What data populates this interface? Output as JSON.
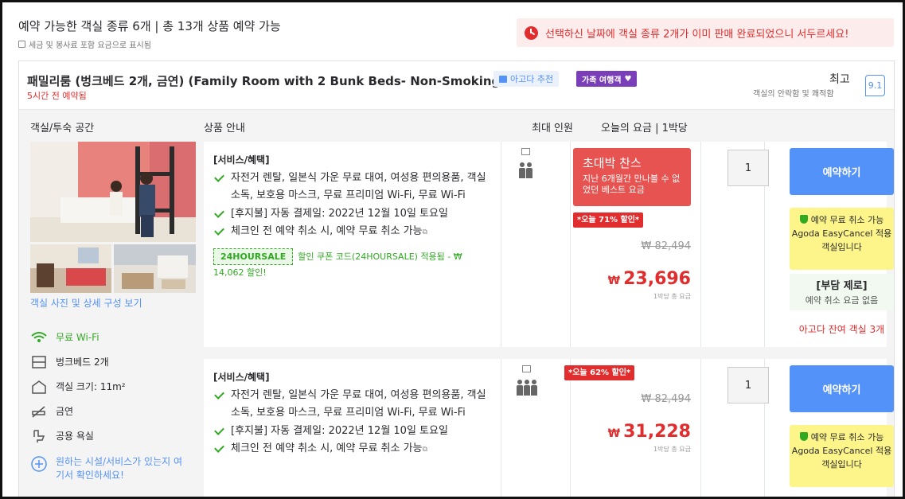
{
  "header": {
    "title": "예약 가능한 객실 종류 6개 | 총 13개 상품 예약 가능",
    "tax_note": "세금 및 봉사료 포함 요금으로 표시됨",
    "alert": "선택하신 날짜에 객실 종류 2개가 이미 판매 완료되었으니 서두르세요!"
  },
  "room": {
    "name": "패밀리룸 (벙크베드 2개, 금연) (Family Room with 2 Bunk Beds- Non-Smoking)",
    "booked": "5시간 전 예약됨",
    "badge_recommend": "아고다 추천",
    "badge_family": "가족 여행객",
    "rating_word": "최고",
    "rating_sub": "객실의 안락함 및 쾌적함",
    "score": "9.1"
  },
  "columns": {
    "room_space": "객실/투숙 공간",
    "product": "상품 안내",
    "max_guests": "최대 인원",
    "price": "오늘의 요금 | 1박당"
  },
  "left": {
    "photo_link": "객실 사진 및 상세 구성 보기",
    "facts": [
      "무료 Wi-Fi",
      "벙크베드 2개",
      "객실 크기: 11m²",
      "금연",
      "공용 욕실"
    ],
    "more_link": "원하는 시설/서비스가 있는지 여기서 확인하세요!"
  },
  "offers": [
    {
      "benefits_title": "[서비스/혜택]",
      "benefits": [
        "자전거 렌탈, 일본식 가운 무료 대여, 여성용 편의용품, 객실 소독, 보호용 마스크, 무료 프리미엄 Wi-Fi, 무료 Wi-Fi",
        "[후지불] 자동 결제일: 2022년 12월 10일 토요일",
        "체크인 전 예약 취소 시, 예약 무료 취소 가능"
      ],
      "coupon_code": "24HOURSALE",
      "coupon_text": "할인 쿠폰 코드(24HOURSALE) 적용됨 - ₩ 14,062 할인!",
      "deal_title": "초대박 찬스",
      "deal_sub": "지난 6개월간 만나볼 수 없었던 베스트 요금",
      "discount": "*오늘 71% 할인*",
      "original_price": "₩ 82,494",
      "currency": "₩",
      "price": "23,696",
      "price_note": "1박당 총 요금",
      "quantity": "1",
      "book_label": "예약하기",
      "free_cancel": "예약 무료 취소 가능",
      "easy_cancel": "Agoda EasyCancel 적용 객실입니다",
      "zero_title": "[부담 제로]",
      "zero_sub": "예약 취소 요금 없음",
      "rooms_left": "아고다 잔여 객실 3개",
      "guests": 2
    },
    {
      "benefits_title": "[서비스/혜택]",
      "benefits": [
        "자전거 렌탈, 일본식 가운 무료 대여, 여성용 편의용품, 객실 소독, 보호용 마스크, 무료 프리미엄 Wi-Fi, 무료 Wi-Fi",
        "[후지불] 자동 결제일: 2022년 12월 10일 토요일",
        "체크인 전 예약 취소 시, 예약 무료 취소 가능"
      ],
      "discount": "*오늘 62% 할인*",
      "original_price": "₩ 82,494",
      "currency": "₩",
      "price": "31,228",
      "price_note": "1박당 총 요금",
      "quantity": "1",
      "book_label": "예약하기",
      "free_cancel": "예약 무료 취소 가능",
      "easy_cancel": "Agoda EasyCancel 적용 객실입니다",
      "guests": 3
    }
  ]
}
